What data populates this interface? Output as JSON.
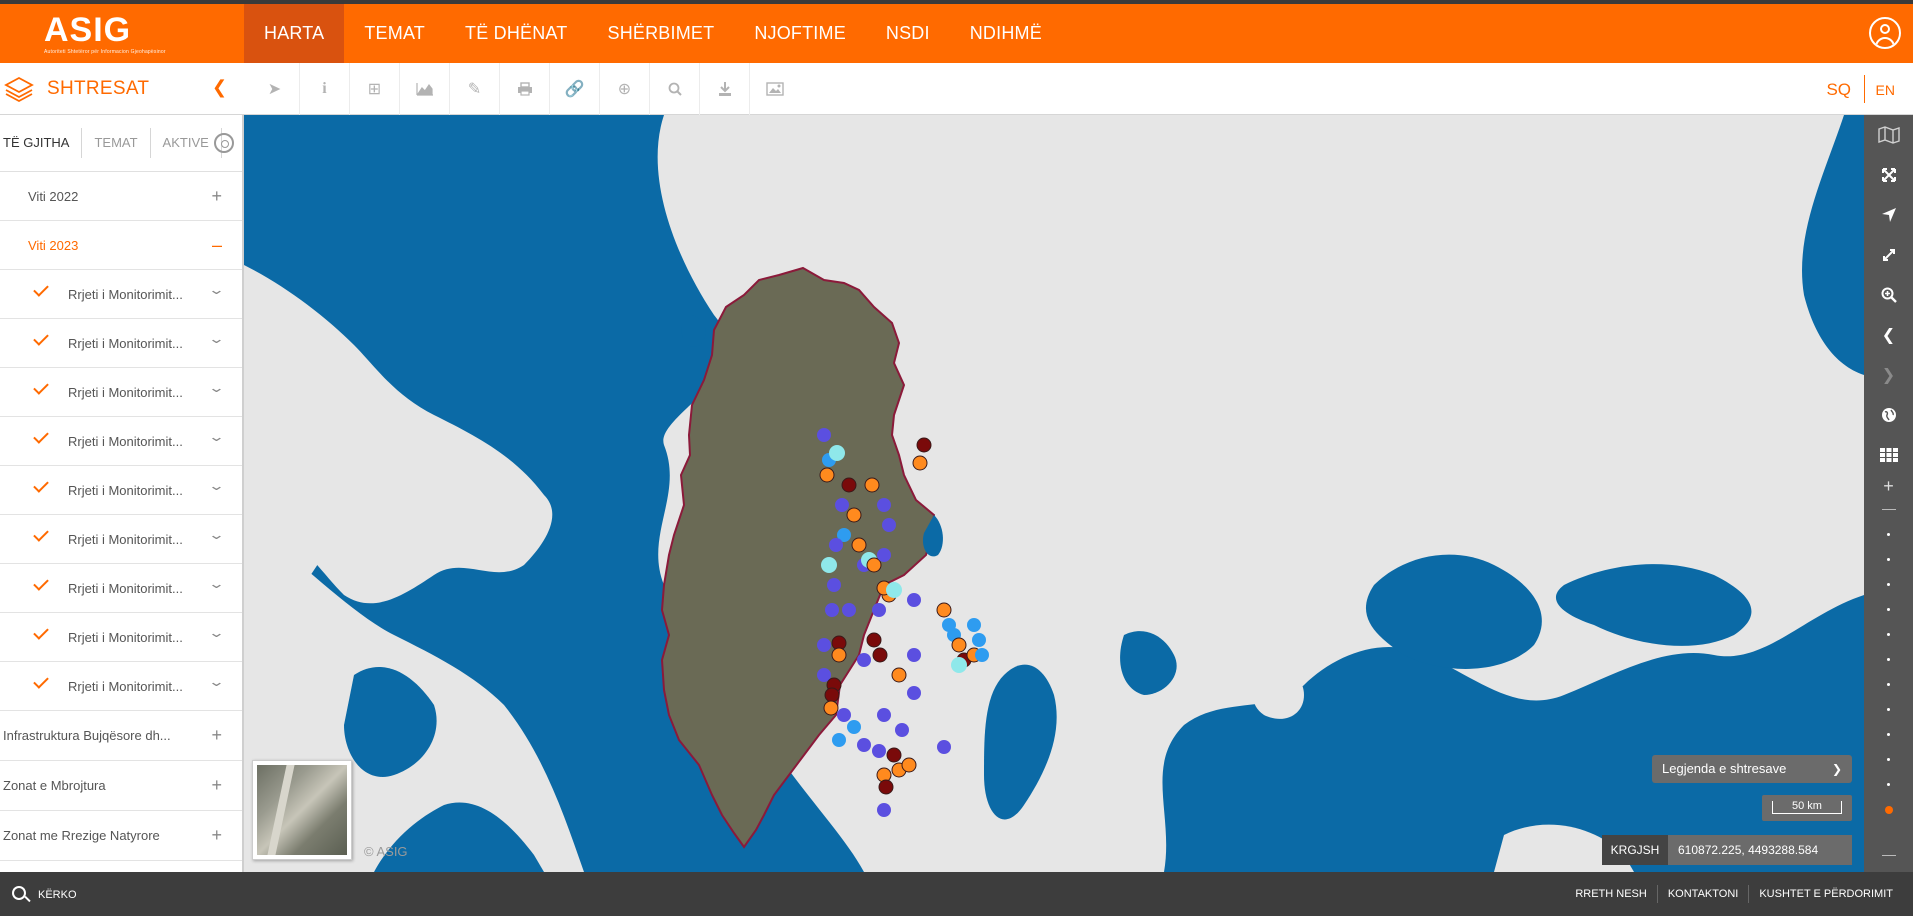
{
  "brand": {
    "logo_text": "ASIG",
    "logo_sub": "Autoriteti Shtetëror për Informacion Gjeohapësinor",
    "accent": "#ff6a00"
  },
  "nav": {
    "items": [
      "HARTA",
      "TEMAT",
      "TË DHËNAT",
      "SHËRBIMET",
      "NJOFTIME",
      "NSDI",
      "NDIHMË"
    ],
    "active": "HARTA"
  },
  "toolbar": {
    "title": "SHTRESAT",
    "tools": [
      "pointer-icon",
      "info-icon",
      "plus-square-icon",
      "area-chart-icon",
      "edit-icon",
      "print-icon",
      "link-icon",
      "plus-circle-icon",
      "search-icon",
      "download-icon",
      "image-icon"
    ],
    "lang_sq": "SQ",
    "lang_en": "EN"
  },
  "sidebar": {
    "tabs": [
      "TË GJITHA",
      "TEMAT",
      "AKTIVE"
    ],
    "groups": [
      {
        "label": "Viti 2022",
        "open": false
      },
      {
        "label": "Viti 2023",
        "open": true
      }
    ],
    "layer_items": [
      "Rrjeti i Monitorimit...",
      "Rrjeti i Monitorimit...",
      "Rrjeti i Monitorimit...",
      "Rrjeti i Monitorimit...",
      "Rrjeti i Monitorimit...",
      "Rrjeti i Monitorimit...",
      "Rrjeti i Monitorimit...",
      "Rrjeti i Monitorimit...",
      "Rrjeti i Monitorimit..."
    ],
    "categories": [
      "Infrastruktura Bujqësore dh...",
      "Zonat e Mbrojtura",
      "Zonat me Rrezige Natyrore"
    ]
  },
  "map": {
    "copyright": "© ASIG",
    "legend_label": "Legjenda e shtresave",
    "scale_label": "50 km",
    "crs": "KRGJSH",
    "coords": "610872.225, 4493288.584",
    "colors": {
      "sea": "#0b6aa6",
      "land": "#e6e6e6",
      "country": "#6a6a55",
      "border": "#8b1a3a",
      "dot_orange": "#ff8a1e",
      "dot_blue": "#5b4fe0",
      "dot_cyan": "#8fe8ea",
      "dot_darkred": "#7a0a0a",
      "dot_lightblue": "#2e9cf0"
    }
  },
  "rightbar": {
    "tools": [
      "map-icon",
      "fullscreen-icon",
      "locate-icon",
      "expand-icon",
      "zoom-in-icon",
      "back-icon",
      "forward-icon",
      "globe-icon",
      "grid-icon"
    ]
  },
  "footer": {
    "search_label": "KËRKO",
    "links": [
      "RRETH NESH",
      "KONTAKTONI",
      "KUSHTET E PËRDORIMIT"
    ]
  }
}
